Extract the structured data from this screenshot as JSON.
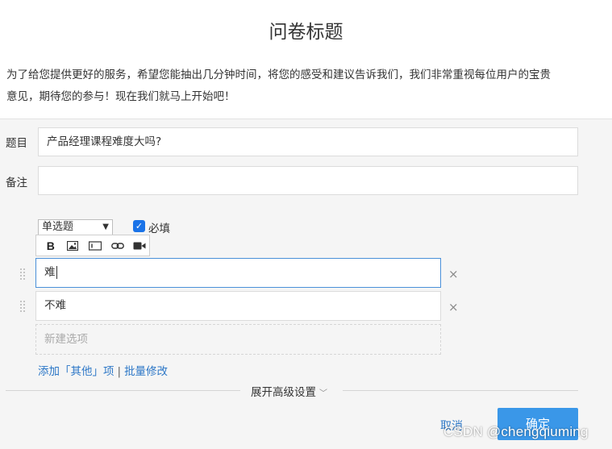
{
  "header": {
    "title": "问卷标题",
    "intro_line1": "为了给您提供更好的服务，希望您能抽出几分钟时间，将您的感受和建议告诉我们，我们非常重视每位用户的宝贵",
    "intro_line2": "意见，期待您的参与！现在我们就马上开始吧！"
  },
  "question": {
    "title_label": "题目",
    "title_value": "产品经理课程难度大吗?",
    "note_label": "备注",
    "note_value": "",
    "type_selected": "单选题",
    "required_label": "必填",
    "required_checked": true
  },
  "toolbar": {
    "buttons": [
      "bold-icon",
      "image-icon",
      "textbox-icon",
      "link-icon",
      "video-icon"
    ],
    "bold_glyph": "B"
  },
  "options": [
    {
      "text": "难",
      "active": true
    },
    {
      "text": "不难",
      "active": false
    }
  ],
  "remove_glyph": "×",
  "new_option_placeholder": "新建选项",
  "links": {
    "add_other": "添加「其他」项",
    "separator": "|",
    "batch_edit": "批量修改"
  },
  "advanced": {
    "label": "展开高级设置",
    "chevron": "﹀"
  },
  "footer": {
    "cancel": "取消",
    "confirm": "确定",
    "watermark": "CSDN @chengqiuming"
  },
  "colors": {
    "accent": "#3a97e8",
    "link": "#2e78c7",
    "check": "#1a73e8"
  }
}
